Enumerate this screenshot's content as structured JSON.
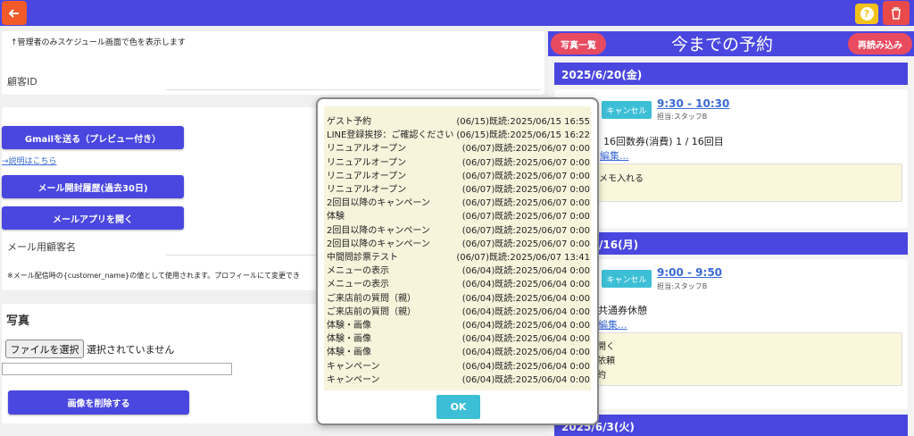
{
  "toolbar": {
    "back_icon": "arrow-left-icon",
    "help_label": "?",
    "trash_icon": "trash-icon"
  },
  "profile": {
    "admin_note": "↑管理者のみスケジュール画面で色を表示します",
    "customer_id_label": "顧客ID"
  },
  "mail": {
    "send_gmail": "Gmailを送る（プレビュー付き）",
    "help_link": "→説明はこちら",
    "open_history": "メール開封履歴(過去30日)",
    "open_app": "メールアプリを開く",
    "name_label": "メール用顧客名",
    "name_note": "※メール配信時の{customer_name}の値として使用されます。プロフィールにて変更でき"
  },
  "photo": {
    "title": "写真",
    "choose_file": "ファイルを選択",
    "no_file": "選択されていません",
    "delete": "画像を削除する"
  },
  "right_panel": {
    "photos_button": "写真一覧",
    "title": "今までの予約",
    "reload_button": "再読み込み",
    "dates": [
      "2025/6/20(金)",
      "/16(月)",
      "2025/6/3(火)"
    ],
    "cards": [
      {
        "cancel": "キャンセル",
        "time": "9:30 - 10:30",
        "staff": "担当:スタッフB",
        "ticket": "16回数券(消費) 1 / 16回目",
        "edit": "編集...",
        "memo": "メモ入れる"
      },
      {
        "cancel": "キャンセル",
        "time": "9:00 - 9:50",
        "staff": "担当:スタッフB",
        "ticket": "共通券休憩",
        "edit": "編集...",
        "memo_lines": [
          "開く",
          "依頼",
          "約"
        ]
      }
    ]
  },
  "modal": {
    "ok": "OK",
    "rows": [
      {
        "title": "ゲスト予約",
        "date": "(06/15)既読:2025/06/15 16:55"
      },
      {
        "title": "LINE登録挨拶：ご確認ください",
        "date": "(06/15)既読:2025/06/15 16:22"
      },
      {
        "title": "リニュアルオープン",
        "date": "(06/07)既読:2025/06/07 0:00"
      },
      {
        "title": "リニュアルオープン",
        "date": "(06/07)既読:2025/06/07 0:00"
      },
      {
        "title": "リニュアルオープン",
        "date": "(06/07)既読:2025/06/07 0:00"
      },
      {
        "title": "リニュアルオープン",
        "date": "(06/07)既読:2025/06/07 0:00"
      },
      {
        "title": "2回目以降のキャンペーン",
        "date": "(06/07)既読:2025/06/07 0:00"
      },
      {
        "title": "体験",
        "date": "(06/07)既読:2025/06/07 0:00"
      },
      {
        "title": "2回目以降のキャンペーン",
        "date": "(06/07)既読:2025/06/07 0:00"
      },
      {
        "title": "2回目以降のキャンペーン",
        "date": "(06/07)既読:2025/06/07 0:00"
      },
      {
        "title": "中間問診票テスト",
        "date": "(06/07)既読:2025/06/07 13:41"
      },
      {
        "title": "メニューの表示",
        "date": "(06/04)既読:2025/06/04 0:00"
      },
      {
        "title": "メニューの表示",
        "date": "(06/04)既読:2025/06/04 0:00"
      },
      {
        "title": "ご来店前の質問（親）",
        "date": "(06/04)既読:2025/06/04 0:00"
      },
      {
        "title": "ご来店前の質問（親）",
        "date": "(06/04)既読:2025/06/04 0:00"
      },
      {
        "title": "体験・画像",
        "date": "(06/04)既読:2025/06/04 0:00"
      },
      {
        "title": "体験・画像",
        "date": "(06/04)既読:2025/06/04 0:00"
      },
      {
        "title": "体験・画像",
        "date": "(06/04)既読:2025/06/04 0:00"
      },
      {
        "title": "キャンペーン",
        "date": "(06/04)既読:2025/06/04 0:00"
      },
      {
        "title": "キャンペーン",
        "date": "(06/04)既読:2025/06/04 0:00"
      }
    ]
  }
}
